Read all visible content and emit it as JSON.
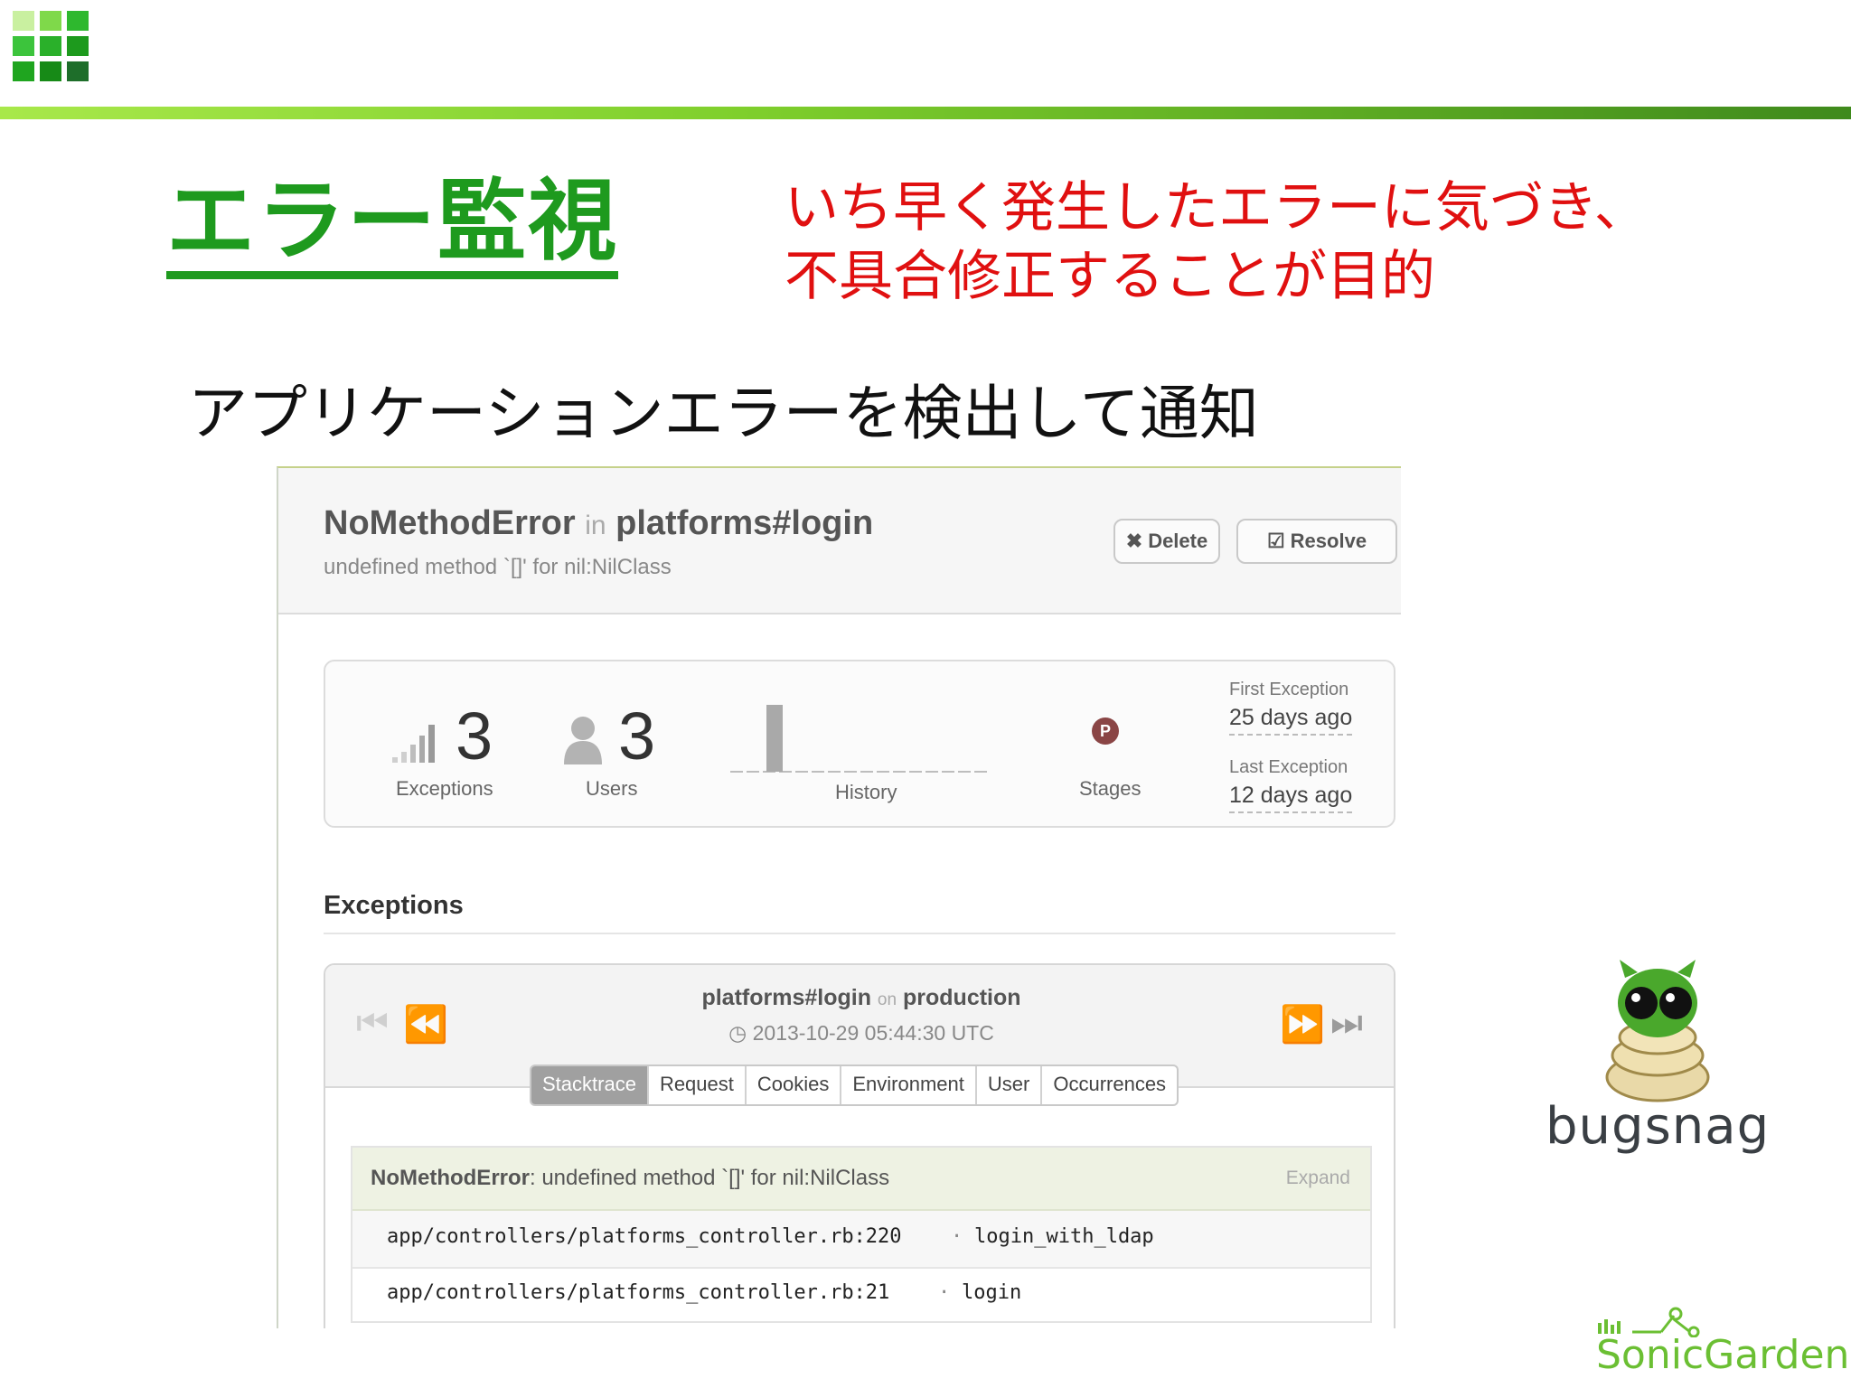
{
  "slide": {
    "title": "エラー監視",
    "note_line1": "いち早く発生したエラーに気づき、",
    "note_line2": "不具合修正することが目的",
    "subtitle": "アプリケーションエラーを検出して通知"
  },
  "error": {
    "class": "NoMethodError",
    "in": "in",
    "context": "platforms#login",
    "message": "undefined method `[]' for nil:NilClass",
    "buttons": {
      "delete": "Delete",
      "resolve": "Resolve"
    }
  },
  "stats": {
    "exceptions_count": "3",
    "exceptions_label": "Exceptions",
    "users_count": "3",
    "users_label": "Users",
    "history_label": "History",
    "stage_badge": "P",
    "stages_label": "Stages",
    "first_exception_label": "First Exception",
    "first_exception_value": "25 days ago",
    "last_exception_label": "Last Exception",
    "last_exception_value": "12 days ago"
  },
  "exceptions_section": {
    "heading": "Exceptions",
    "context": "platforms#login",
    "on": "on",
    "stage": "production",
    "timestamp": "2013-10-29 05:44:30 UTC",
    "tabs": [
      "Stacktrace",
      "Request",
      "Cookies",
      "Environment",
      "User",
      "Occurrences"
    ],
    "active_tab": "Stacktrace",
    "stacktrace": {
      "error_class": "NoMethodError",
      "error_message": ": undefined method `[]' for nil:NilClass",
      "expand": "Expand",
      "frames": [
        {
          "file": "app/controllers/platforms_controller.rb:220",
          "method": "login_with_ldap"
        },
        {
          "file": "app/controllers/platforms_controller.rb:21",
          "method": "login"
        }
      ]
    }
  },
  "logos": {
    "bugsnag": "bugsnag",
    "sonicgarden": "SonicGarden"
  },
  "colors": {
    "title_green": "#1e9a1e",
    "note_red": "#e01010"
  }
}
